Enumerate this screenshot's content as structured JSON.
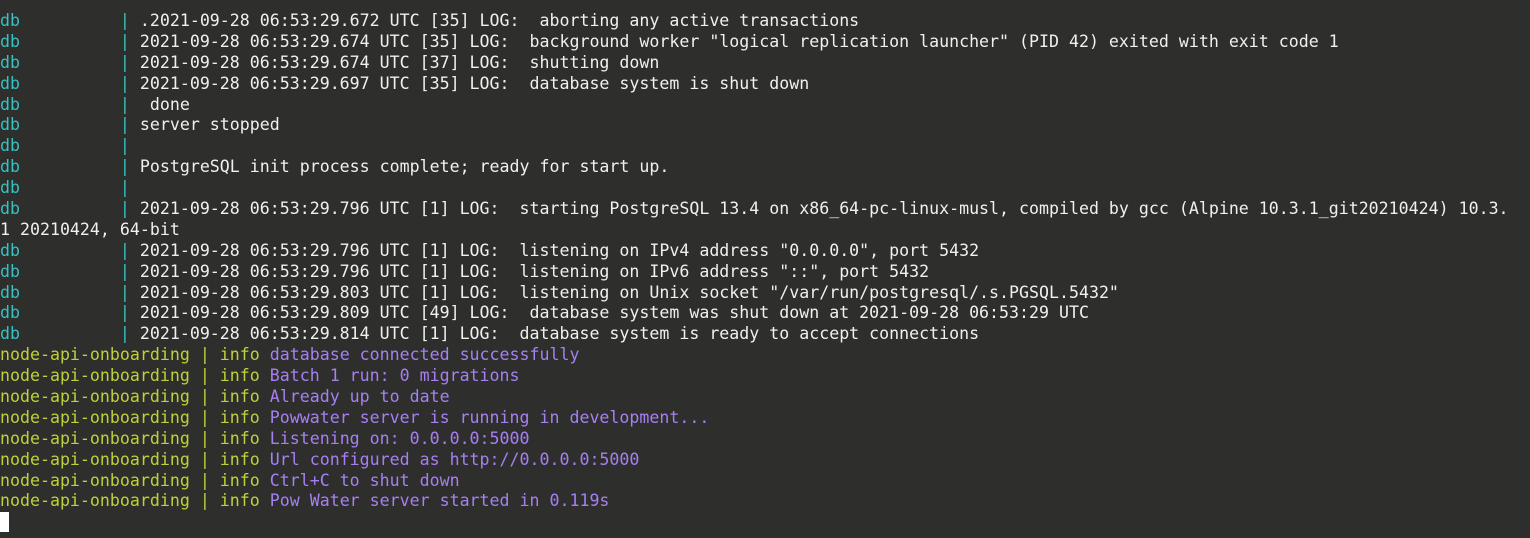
{
  "terminal": {
    "db_lines": [
      {
        "prefix": "db          ",
        "sep": "| ",
        "text": ".2021-09-28 06:53:29.672 UTC [35] LOG:  aborting any active transactions"
      },
      {
        "prefix": "db          ",
        "sep": "| ",
        "text": "2021-09-28 06:53:29.674 UTC [35] LOG:  background worker \"logical replication launcher\" (PID 42) exited with exit code 1"
      },
      {
        "prefix": "db          ",
        "sep": "| ",
        "text": "2021-09-28 06:53:29.674 UTC [37] LOG:  shutting down"
      },
      {
        "prefix": "db          ",
        "sep": "| ",
        "text": "2021-09-28 06:53:29.697 UTC [35] LOG:  database system is shut down"
      },
      {
        "prefix": "db          ",
        "sep": "| ",
        "text": " done"
      },
      {
        "prefix": "db          ",
        "sep": "| ",
        "text": "server stopped"
      },
      {
        "prefix": "db          ",
        "sep": "| ",
        "text": ""
      },
      {
        "prefix": "db          ",
        "sep": "| ",
        "text": "PostgreSQL init process complete; ready for start up."
      },
      {
        "prefix": "db          ",
        "sep": "| ",
        "text": ""
      },
      {
        "prefix": "db          ",
        "sep": "| ",
        "text": "2021-09-28 06:53:29.796 UTC [1] LOG:  starting PostgreSQL 13.4 on x86_64-pc-linux-musl, compiled by gcc (Alpine 10.3.1_git20210424) 10.3."
      }
    ],
    "wrap_line": "1 20210424, 64-bit",
    "db_lines_2": [
      {
        "prefix": "db          ",
        "sep": "| ",
        "text": "2021-09-28 06:53:29.796 UTC [1] LOG:  listening on IPv4 address \"0.0.0.0\", port 5432"
      },
      {
        "prefix": "db          ",
        "sep": "| ",
        "text": "2021-09-28 06:53:29.796 UTC [1] LOG:  listening on IPv6 address \"::\", port 5432"
      },
      {
        "prefix": "db          ",
        "sep": "| ",
        "text": "2021-09-28 06:53:29.803 UTC [1] LOG:  listening on Unix socket \"/var/run/postgresql/.s.PGSQL.5432\""
      },
      {
        "prefix": "db          ",
        "sep": "| ",
        "text": "2021-09-28 06:53:29.809 UTC [49] LOG:  database system was shut down at 2021-09-28 06:53:29 UTC"
      },
      {
        "prefix": "db          ",
        "sep": "| ",
        "text": "2021-09-28 06:53:29.814 UTC [1] LOG:  database system is ready to accept connections"
      }
    ],
    "node_lines": [
      {
        "prefix": "node-api-onboarding ",
        "sep": "| ",
        "level": "info",
        "text": " database connected successfully"
      },
      {
        "prefix": "node-api-onboarding ",
        "sep": "| ",
        "level": "info",
        "text": " Batch 1 run: 0 migrations"
      },
      {
        "prefix": "node-api-onboarding ",
        "sep": "| ",
        "level": "info",
        "text": " Already up to date"
      },
      {
        "prefix": "node-api-onboarding ",
        "sep": "| ",
        "level": "info",
        "text": " Powwater server is running in development..."
      },
      {
        "prefix": "node-api-onboarding ",
        "sep": "| ",
        "level": "info",
        "text": " Listening on: 0.0.0.0:5000"
      },
      {
        "prefix": "node-api-onboarding ",
        "sep": "| ",
        "level": "info",
        "text": " Url configured as http://0.0.0.0:5000"
      },
      {
        "prefix": "node-api-onboarding ",
        "sep": "| ",
        "level": "info",
        "text": " Ctrl+C to shut down"
      },
      {
        "prefix": "node-api-onboarding ",
        "sep": "| ",
        "level": "info",
        "text": " Pow Water server started in 0.119s"
      }
    ],
    "colors": {
      "background": "#2e2f2c",
      "db_service": "#34c2c2",
      "node_service": "#c0d038",
      "node_message": "#a67ff2",
      "text": "#f0f0ee"
    }
  }
}
